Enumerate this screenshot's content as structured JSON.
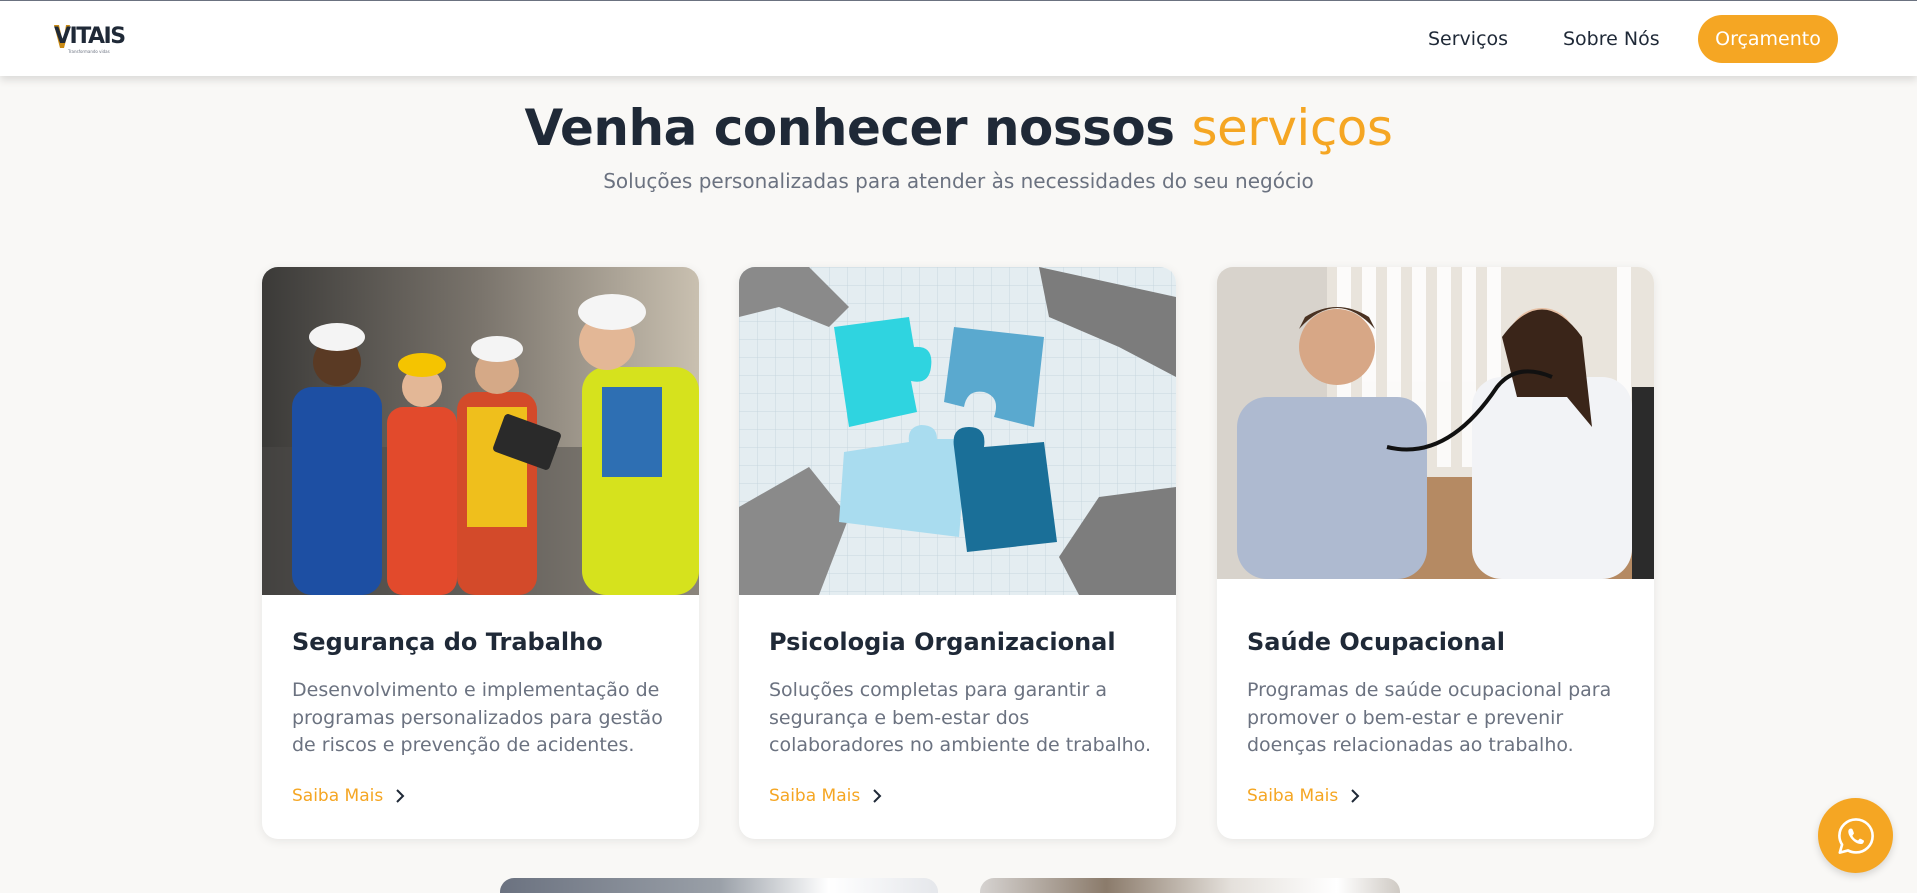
{
  "header": {
    "logo_text": "VITAIS",
    "logo_tagline": "Transformando vidas",
    "nav": {
      "servicos": "Serviços",
      "sobre": "Sobre Nós",
      "cta": "Orçamento"
    }
  },
  "hero": {
    "title_main": "Venha conhecer nossos",
    "title_accent": "serviços",
    "subtitle": "Soluções personalizadas para atender às necessidades do seu negócio"
  },
  "services": [
    {
      "title": "Segurança do Trabalho",
      "description": "Desenvolvimento e implementação de programas personalizados para gestão de riscos e prevenção de acidentes.",
      "link": "Saiba Mais",
      "image": "workers-safety-photo"
    },
    {
      "title": "Psicologia Organizacional",
      "description": "Soluções completas para garantir a segurança e bem-estar dos colaboradores no ambiente de trabalho.",
      "link": "Saiba Mais",
      "image": "puzzle-pieces-photo"
    },
    {
      "title": "Saúde Ocupacional",
      "description": "Programas de saúde ocupacional para promover o bem-estar e prevenir doenças relacionadas ao trabalho.",
      "link": "Saiba Mais",
      "image": "doctor-patient-photo"
    }
  ],
  "floating": {
    "whatsapp_icon": "whatsapp-icon"
  },
  "colors": {
    "accent": "#f5a623",
    "text_dark": "#1f2937",
    "text_muted": "#6b7280",
    "background": "#f9f8f6"
  }
}
